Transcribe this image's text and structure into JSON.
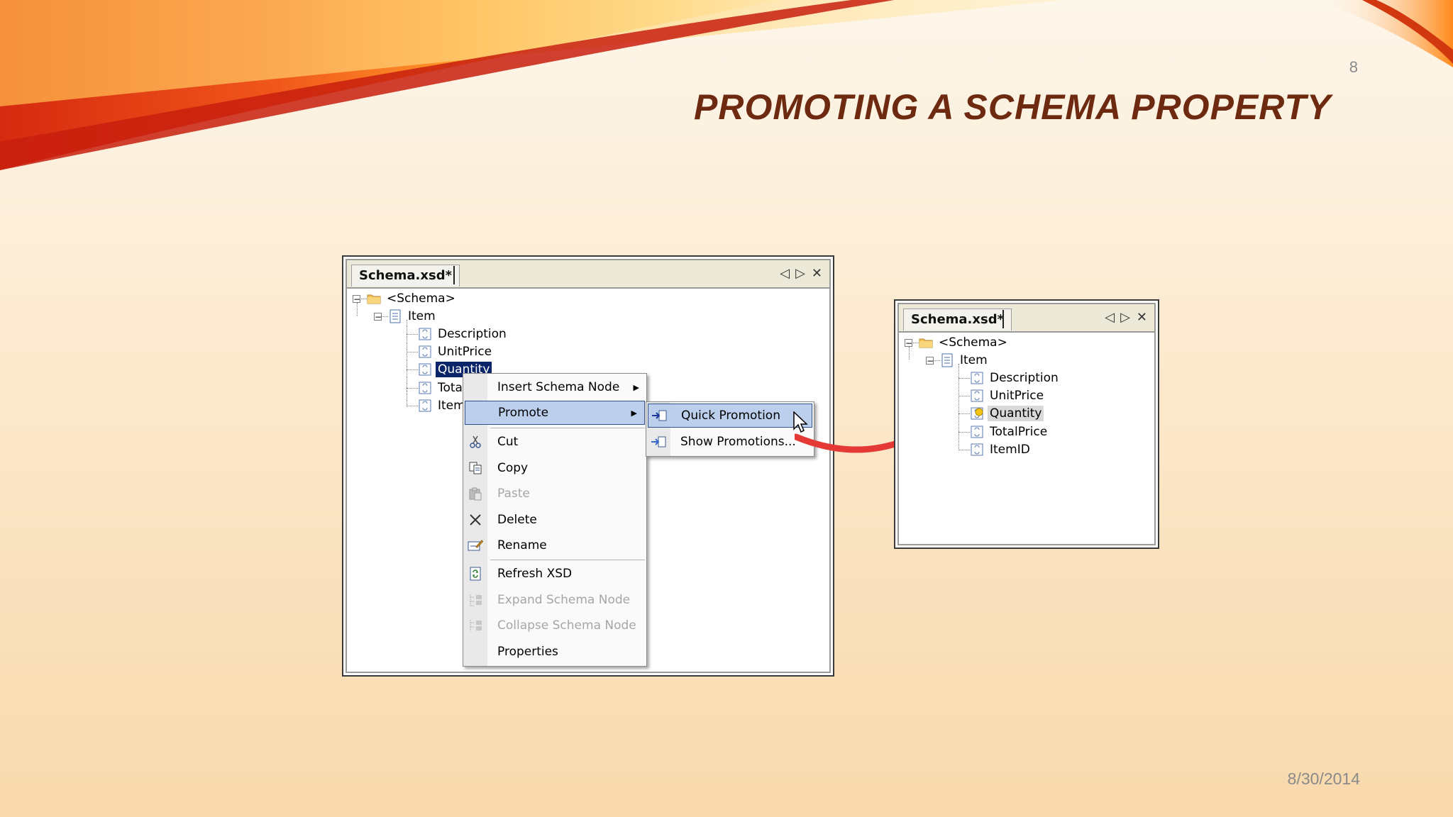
{
  "page_number": "8",
  "title": "PROMOTING A SCHEMA PROPERTY",
  "date": "8/30/2014",
  "left_window": {
    "tab": "Schema.xsd*",
    "ctrl_prev": "◁",
    "ctrl_next": "▷",
    "ctrl_close": "✕",
    "tree": {
      "root": "<Schema>",
      "item": "Item",
      "children": [
        "Description",
        "UnitPrice",
        "Quantity",
        "Tota",
        "Item"
      ]
    }
  },
  "context_menu": {
    "items": [
      {
        "label": "Insert Schema Node",
        "submenu": true
      },
      {
        "label": "Promote",
        "submenu": true,
        "active": true
      },
      {
        "label": "Cut"
      },
      {
        "label": "Copy"
      },
      {
        "label": "Paste",
        "disabled": true
      },
      {
        "label": "Delete"
      },
      {
        "label": "Rename"
      },
      {
        "label": "Refresh XSD"
      },
      {
        "label": "Expand Schema Node",
        "disabled": true
      },
      {
        "label": "Collapse Schema Node",
        "disabled": true
      },
      {
        "label": "Properties"
      }
    ],
    "submenu_arrow": "▶"
  },
  "submenu": {
    "items": [
      {
        "label": "Quick Promotion",
        "active": true
      },
      {
        "label": "Show Promotions..."
      }
    ]
  },
  "right_window": {
    "tab": "Schema.xsd*",
    "ctrl_prev": "◁",
    "ctrl_next": "▷",
    "ctrl_close": "✕",
    "tree": {
      "root": "<Schema>",
      "item": "Item",
      "children": [
        "Description",
        "UnitPrice",
        "Quantity",
        "TotalPrice",
        "ItemID"
      ]
    }
  },
  "colors": {
    "title": "#6d2a10",
    "selection": "#0a246a",
    "menu_highlight": "#bcd0ee",
    "arrow": "#e53935"
  }
}
